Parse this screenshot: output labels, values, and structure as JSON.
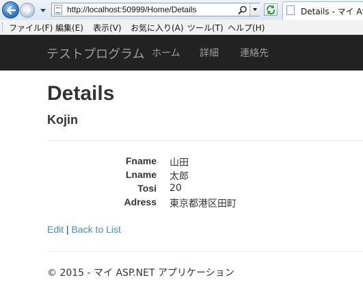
{
  "browser": {
    "address_url": "http://localhost:50999/Home/Details",
    "tab_title": "Details - マイ ASP",
    "icons": {
      "back": "back-arrow-icon",
      "forward": "forward-arrow-icon",
      "search": "magnifier-icon",
      "refresh": "refresh-icon",
      "page": "page-icon"
    }
  },
  "menubar": {
    "items": [
      "ファイル(F)",
      "編集(E)",
      "表示(V)",
      "お気に入り(A)",
      "ツール(T)",
      "ヘルプ(H)"
    ]
  },
  "navbar": {
    "brand": "テストプログラム",
    "links": [
      "ホーム",
      "詳細",
      "連絡先"
    ]
  },
  "page": {
    "title": "Details",
    "subtitle": "Kojin",
    "fields": [
      {
        "label": "Fname",
        "value": "山田"
      },
      {
        "label": "Lname",
        "value": "太郎"
      },
      {
        "label": "Tosi",
        "value": "20"
      },
      {
        "label": "Adress",
        "value": "東京都港区田町"
      }
    ],
    "edit_link": "Edit",
    "separator": "|",
    "back_link": "Back to List",
    "footer": "© 2015 - マイ ASP.NET アプリケーション"
  },
  "colors": {
    "navbar_bg": "#222222",
    "navbar_text": "#9d9d9d",
    "link": "#428bca",
    "text": "#333333"
  }
}
